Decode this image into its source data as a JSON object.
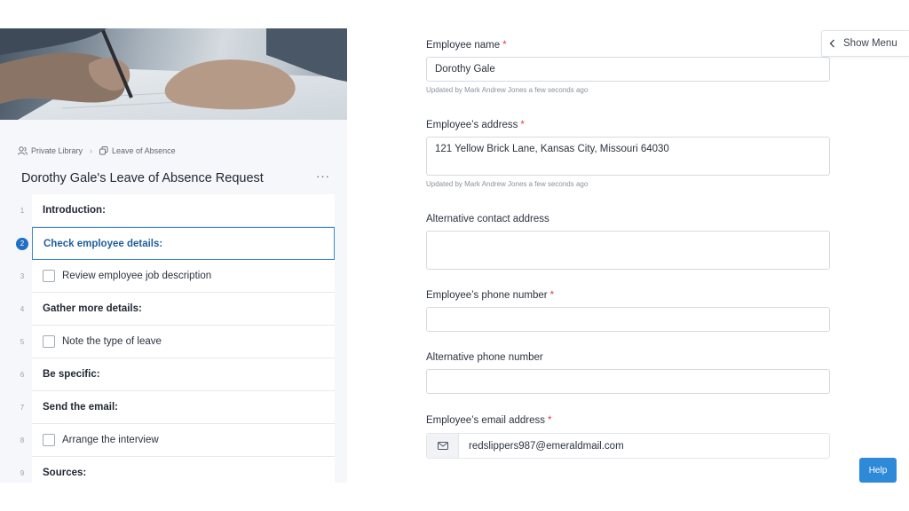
{
  "breadcrumb": {
    "library": "Private Library",
    "folder": "Leave of Absence"
  },
  "document": {
    "title": "Dorothy Gale's Leave of Absence Request",
    "more": "···"
  },
  "steps": [
    {
      "num": "1",
      "label": "Introduction:",
      "kind": "heading"
    },
    {
      "num": "2",
      "label": "Check employee details:",
      "kind": "active"
    },
    {
      "num": "3",
      "label": "Review employee job description",
      "kind": "task"
    },
    {
      "num": "4",
      "label": "Gather more details:",
      "kind": "heading"
    },
    {
      "num": "5",
      "label": "Note the type of leave",
      "kind": "task"
    },
    {
      "num": "6",
      "label": "Be specific:",
      "kind": "heading"
    },
    {
      "num": "7",
      "label": "Send the email:",
      "kind": "heading"
    },
    {
      "num": "8",
      "label": "Arrange the interview",
      "kind": "task"
    },
    {
      "num": "9",
      "label": "Sources:",
      "kind": "heading"
    }
  ],
  "form": {
    "name": {
      "label": "Employee name",
      "required": "*",
      "value": "Dorothy Gale",
      "updated": "Updated by Mark Andrew Jones a few seconds ago"
    },
    "address": {
      "label": "Employee’s address",
      "required": "*",
      "value": "121 Yellow Brick Lane, Kansas City, Missouri 64030",
      "updated": "Updated by Mark Andrew Jones a few seconds ago"
    },
    "alt_address": {
      "label": "Alternative contact address",
      "value": ""
    },
    "phone": {
      "label": "Employee’s phone number",
      "required": "*",
      "value": ""
    },
    "alt_phone": {
      "label": "Alternative phone number",
      "value": ""
    },
    "email": {
      "label": "Employee’s email address",
      "required": "*",
      "value": "redslippers987@emeraldmail.com",
      "icon": "envelope-icon"
    }
  },
  "menu": {
    "show_label": "Show Menu",
    "icon": "chevron-left-icon"
  },
  "help": {
    "label": "Help"
  },
  "colors": {
    "accent": "#1f6fc4",
    "required": "#e0404a",
    "help": "#2e8ad8"
  }
}
